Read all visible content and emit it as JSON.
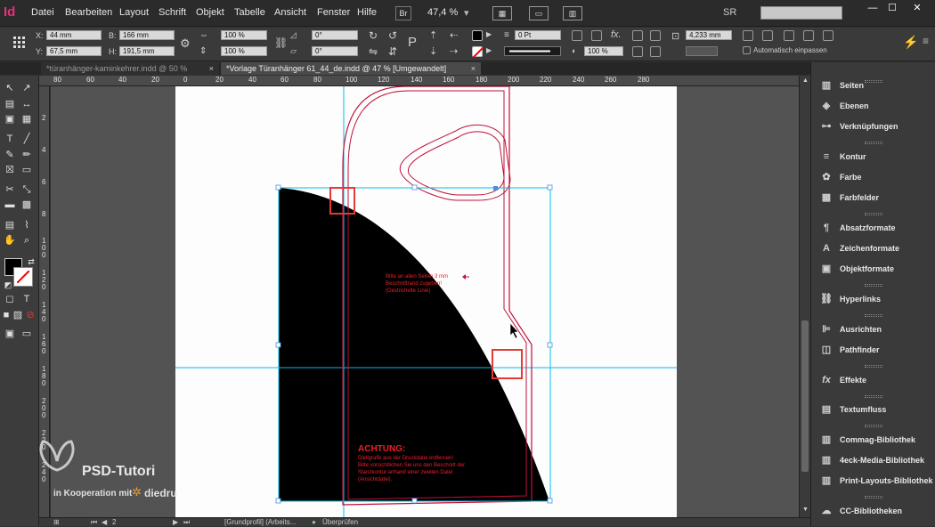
{
  "menubar": {
    "logo": "Id",
    "items": [
      "Datei",
      "Bearbeiten",
      "Layout",
      "Schrift",
      "Objekt",
      "Tabelle",
      "Ansicht",
      "Fenster",
      "Hilfe"
    ],
    "bridge": "Br",
    "zoom": "47,4 %",
    "workspace": "SR"
  },
  "control": {
    "x_label": "X:",
    "x_value": "44 mm",
    "y_label": "Y:",
    "y_value": "67,5 mm",
    "b_label": "B:",
    "b_value": "166 mm",
    "h_label": "H:",
    "h_value": "191,5 mm",
    "scale_x": "100 %",
    "scale_y": "100 %",
    "angle": "0°",
    "shear": "0°",
    "stroke_weight": "0 Pt",
    "opacity": "100 %",
    "dimension": "4,233 mm",
    "auto_fit": "Automatisch einpassen"
  },
  "tabs": [
    {
      "label": "*türanhänger-kaminkehrer.indd @ 50 %",
      "close": "×"
    },
    {
      "label": "*Vorlage Türanhänger 61_44_de.indd @ 47 % [Umgewandelt]",
      "close": "×"
    }
  ],
  "ruler": {
    "h": [
      "80",
      "60",
      "40",
      "20",
      "0",
      "20",
      "40",
      "60",
      "80",
      "100",
      "120",
      "140",
      "160",
      "180",
      "200",
      "220",
      "240",
      "260",
      "280"
    ],
    "v": [
      "2",
      "4",
      "6",
      "8",
      "1\n0\n0",
      "1\n2\n0",
      "1\n4\n0",
      "1\n6\n0",
      "1\n8\n0",
      "2\n0\n0",
      "2\n2\n0",
      "2\n4\n0"
    ]
  },
  "document": {
    "note_text": "Bitte an allen Seiten 3 mm\nBeschnittrand zugeben!\n(Gestrichelte Linie)",
    "warning_title": "ACHTUNG:",
    "warning_body": "Dieligrafik aus der Druckdatei entfernen!\nBitte vorsichtlichen Sie uns den Beschnitt der\nStanzkontur anhand einer zweiten Datei\n(Ansichtdatei).",
    "guide_color": "#00c0e8",
    "die_color": "#c0103a",
    "selection_color": "#4a90e2",
    "highlight_color": "#e53935"
  },
  "status": {
    "page": "2",
    "profile": "[Grundprofil] (Arbeits...",
    "preflight": "Überprüfen"
  },
  "panel": {
    "items": [
      {
        "label": "Seiten",
        "icon": "pages-icon"
      },
      {
        "label": "Ebenen",
        "icon": "layers-icon"
      },
      {
        "label": "Verknüpfungen",
        "icon": "links-icon"
      },
      {
        "label": "Kontur",
        "icon": "stroke-icon"
      },
      {
        "label": "Farbe",
        "icon": "color-icon"
      },
      {
        "label": "Farbfelder",
        "icon": "swatches-icon"
      },
      {
        "label": "Absatzformate",
        "icon": "paragraph-styles-icon"
      },
      {
        "label": "Zeichenformate",
        "icon": "character-styles-icon"
      },
      {
        "label": "Objektformate",
        "icon": "object-styles-icon"
      },
      {
        "label": "Hyperlinks",
        "icon": "hyperlinks-icon"
      },
      {
        "label": "Ausrichten",
        "icon": "align-icon"
      },
      {
        "label": "Pathfinder",
        "icon": "pathfinder-icon"
      },
      {
        "label": "Effekte",
        "icon": "effects-icon"
      },
      {
        "label": "Textumfluss",
        "icon": "text-wrap-icon"
      },
      {
        "label": "Commag-Bibliothek",
        "icon": "library-icon"
      },
      {
        "label": "4eck-Media-Bibliothek",
        "icon": "library-icon"
      },
      {
        "label": "Print-Layouts-Bibliothek",
        "icon": "library-icon"
      },
      {
        "label": "CC-Bibliotheken",
        "icon": "cc-libraries-icon"
      }
    ]
  },
  "watermark": {
    "title": "PSD-Tutori",
    "subtitle": "in Kooperation mit",
    "partner": "diedru"
  }
}
